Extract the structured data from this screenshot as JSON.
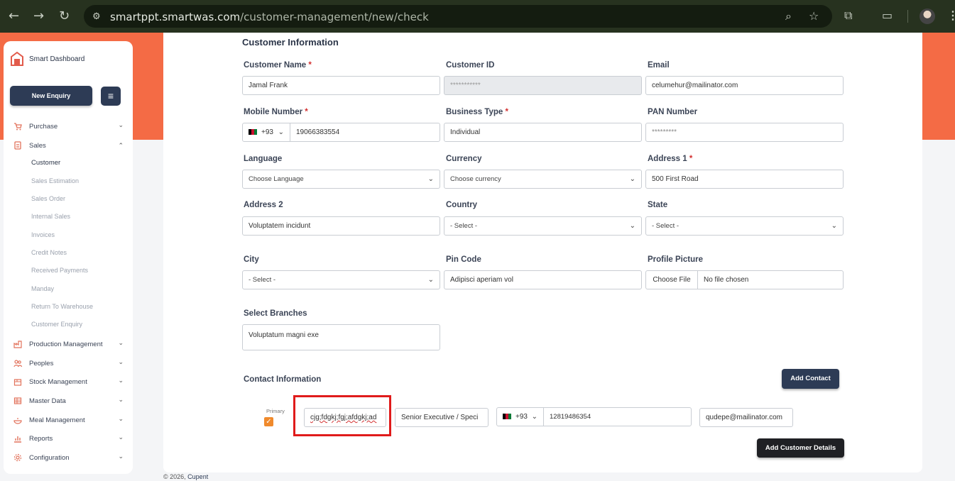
{
  "browser": {
    "url_host": "smartppt.smartwas.com",
    "url_path": "/customer-management/new/check"
  },
  "sidebar": {
    "brand": "Smart Dashboard",
    "new_enquiry_label": "New Enquiry",
    "items": [
      {
        "label": "Purchase",
        "icon": "cart-icon",
        "expanded": false
      },
      {
        "label": "Sales",
        "icon": "sales-icon",
        "expanded": true
      },
      {
        "label": "Production Management",
        "icon": "factory-icon",
        "expanded": false
      },
      {
        "label": "Peoples",
        "icon": "people-icon",
        "expanded": false
      },
      {
        "label": "Stock Management",
        "icon": "box-icon",
        "expanded": false
      },
      {
        "label": "Master Data",
        "icon": "database-icon",
        "expanded": false
      },
      {
        "label": "Meal Management",
        "icon": "meal-icon",
        "expanded": false
      },
      {
        "label": "Reports",
        "icon": "report-icon",
        "expanded": false
      },
      {
        "label": "Configuration",
        "icon": "gear-icon",
        "expanded": false
      }
    ],
    "sales_sub": [
      "Customer",
      "Sales Estimation",
      "Sales Order",
      "Internal Sales",
      "Invoices",
      "Credit Notes",
      "Received Payments",
      "Manday",
      "Return To Warehouse",
      "Customer Enquiry"
    ],
    "active_sub": "Customer"
  },
  "form": {
    "title": "Customer Information",
    "customer_name": {
      "label": "Customer Name",
      "value": "Jamal Frank"
    },
    "customer_id": {
      "label": "Customer ID",
      "value": "***********"
    },
    "email": {
      "label": "Email",
      "value": "celumehur@mailinator.com"
    },
    "mobile": {
      "label": "Mobile Number",
      "code": "+93",
      "value": "19066383554"
    },
    "business_type": {
      "label": "Business Type",
      "value": "Individual"
    },
    "pan": {
      "label": "PAN Number",
      "value": "*********"
    },
    "language": {
      "label": "Language",
      "value": "Choose Language"
    },
    "currency": {
      "label": "Currency",
      "value": "Choose currency"
    },
    "address1": {
      "label": "Address 1",
      "value": "500 First Road"
    },
    "address2": {
      "label": "Address 2",
      "value": "Voluptatem incidunt"
    },
    "country": {
      "label": "Country",
      "value": "- Select -"
    },
    "state": {
      "label": "State",
      "value": "- Select -"
    },
    "city": {
      "label": "City",
      "value": "- Select -"
    },
    "pin": {
      "label": "Pin Code",
      "value": "Adipisci aperiam vol"
    },
    "profile": {
      "label": "Profile Picture",
      "button": "Choose File",
      "status": "No file chosen"
    },
    "branches": {
      "label": "Select Branches",
      "value": "Voluptatum magni exe"
    }
  },
  "contact": {
    "title": "Contact Information",
    "add_label": "Add Contact",
    "primary_label": "Primary",
    "name": "cjg;fdgkj;fgj;afdgkj;ad",
    "designation": "Senior Executive / Speci",
    "code": "+93",
    "phone": "12819486354",
    "email": "qudepe@mailinator.com"
  },
  "submit_label": "Add Customer Details",
  "footer": {
    "copyright": "© 2026,",
    "brand": "Cupent"
  },
  "colors": {
    "accent": "#f46b45",
    "primary": "#2d3b55",
    "highlight": "#e01b1b"
  }
}
